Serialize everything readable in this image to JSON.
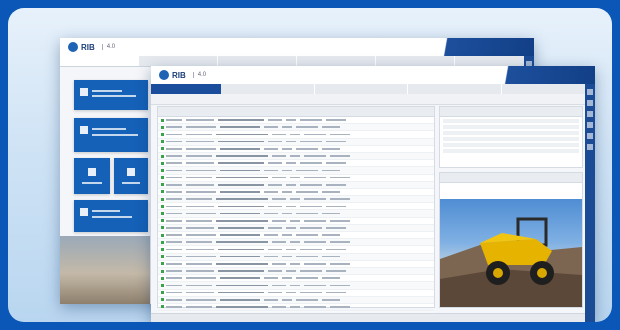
{
  "app": {
    "brand": "RIB",
    "version": "4.0"
  },
  "colors": {
    "page_background": "#0a57b7",
    "accent": "#1561b8",
    "titlebar_wedge": "#123f86"
  },
  "back_window": {
    "tile_count": 5
  },
  "front_window": {
    "grid_rows": 30,
    "detail_fields": 6
  },
  "icons": [
    "rib-logo-icon",
    "dashboard-tile-icon",
    "check-icon",
    "camera-photo-icon"
  ]
}
